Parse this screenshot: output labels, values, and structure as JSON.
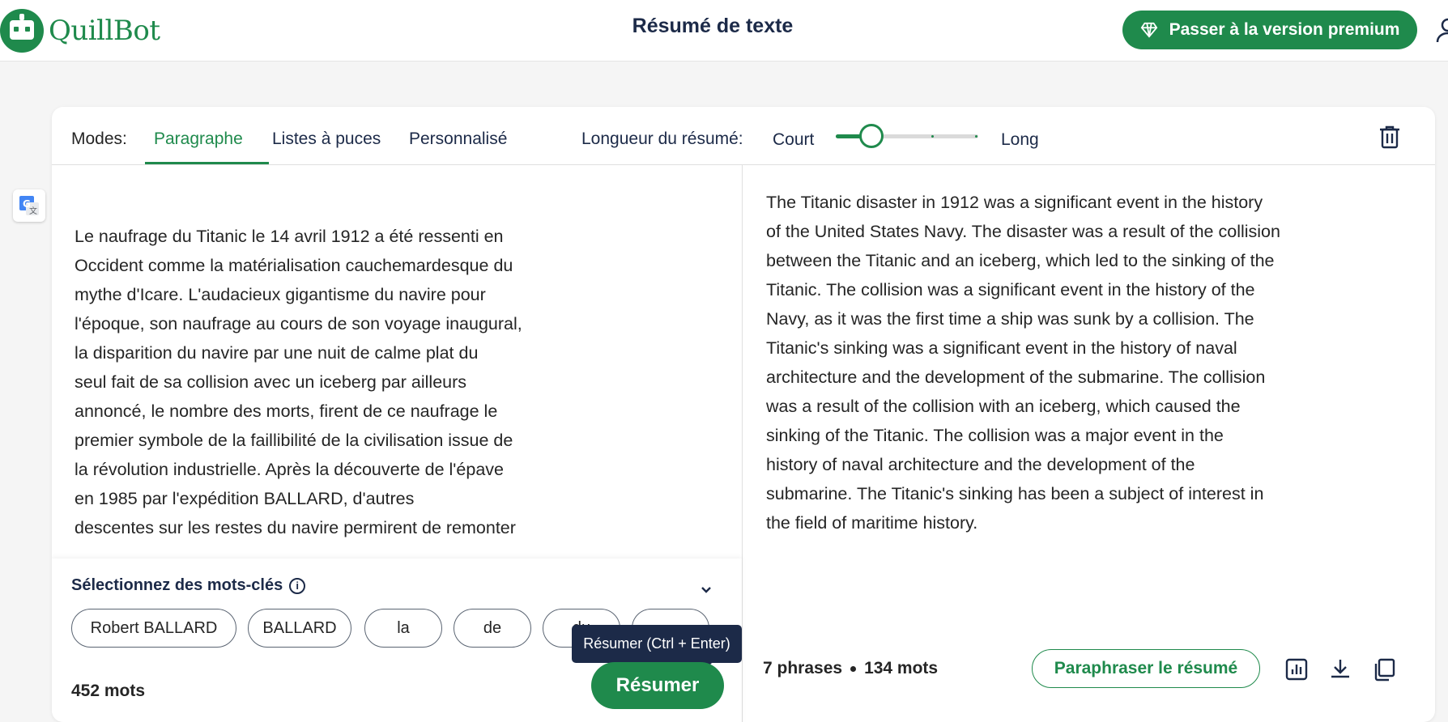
{
  "header": {
    "logo_text": "QuillBot",
    "page_title": "Résumé de texte",
    "premium_label": "Passer à la version premium"
  },
  "toolbar": {
    "modes_label": "Modes:",
    "tabs": [
      {
        "label": "Paragraphe",
        "active": true
      },
      {
        "label": "Listes à puces",
        "active": false
      },
      {
        "label": "Personnalisé",
        "active": false
      }
    ],
    "length_label": "Longueur du résumé:",
    "length_min_label": "Court",
    "length_max_label": "Long",
    "length_value": 0.25
  },
  "input": {
    "text": "Le naufrage du Titanic le 14 avril 1912 a été ressenti en\nOccident comme la matérialisation cauchemardesque du\nmythe d'Icare. L'audacieux gigantisme du navire pour\nl'époque, son naufrage au cours de son voyage inaugural,\nla disparition du navire par une nuit de calme plat du\nseul fait de sa collision avec un iceberg par ailleurs\nannoncé, le nombre des morts, firent de ce naufrage le\npremier symbole de la faillibilité de la civilisation issue de\nla révolution industrielle. Après la découverte de l'épave\nen 1985 par l'expédition BALLARD, d'autres\ndescentes sur les restes du navire permirent de remonter\ndivers échantillons de la coque. Dans ce premier article",
    "keywords_title": "Sélectionnez des mots-clés",
    "keywords": [
      "Robert BALLARD",
      "BALLARD",
      "la",
      "de",
      "du",
      ""
    ],
    "word_count": "452 mots",
    "summarize_label": "Résumer",
    "tooltip": "Résumer (Ctrl + Enter)"
  },
  "output": {
    "text": "The Titanic disaster in 1912 was a significant event in the history\nof the United States Navy. The disaster was a result of the collision\nbetween the Titanic and an iceberg, which led to the sinking of the\nTitanic. The collision was a significant event in the history of the\nNavy, as it was the first time a ship was sunk by a collision. The\nTitanic's sinking was a significant event in the history of naval\narchitecture and the development of the submarine. The collision\nwas a result of the collision with an iceberg, which caused the\nsinking of the Titanic. The collision was a major event in the\nhistory of naval architecture and the development of the\nsubmarine. The Titanic's sinking has been a subject of interest in\nthe field of maritime history.",
    "sentences": "7 phrases",
    "words": "134 mots",
    "paraphrase_label": "Paraphraser le résumé"
  },
  "icons": {
    "premium": "diamond-icon",
    "translate": "google-translate-icon",
    "delete": "trash-icon",
    "info": "info-icon",
    "collapse": "chevron-down-icon",
    "stats": "bar-chart-icon",
    "download": "download-icon",
    "copy": "copy-icon"
  },
  "colors": {
    "brand": "#1f8a4c",
    "navy": "#1c2a48"
  }
}
